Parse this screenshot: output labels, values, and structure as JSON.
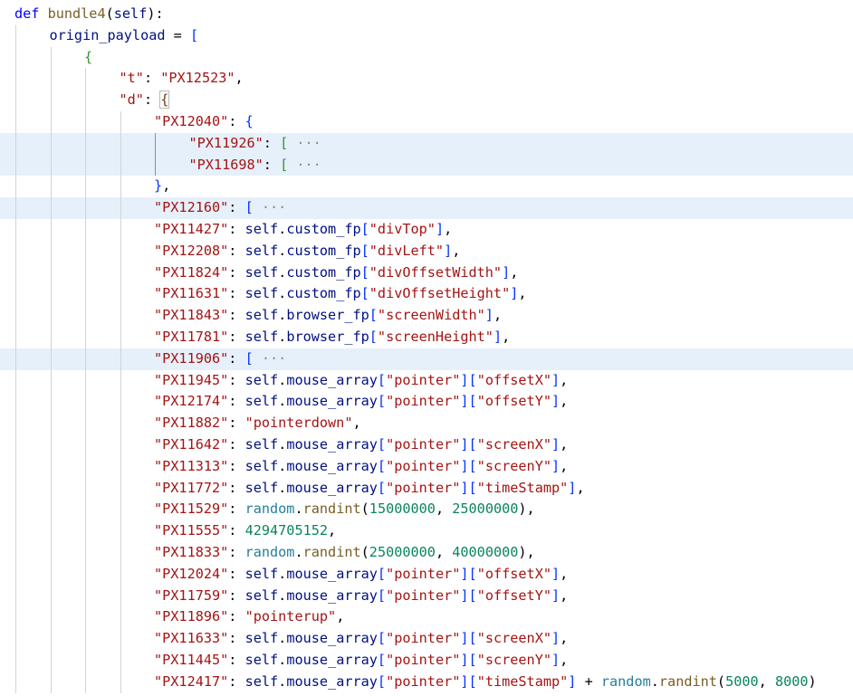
{
  "editor": {
    "lines": [
      {
        "indent": 0,
        "highlight": false,
        "tokens": [
          [
            "kw",
            "def"
          ],
          [
            "op",
            " "
          ],
          [
            "fn",
            "bundle4"
          ],
          [
            "op",
            "("
          ],
          [
            "self",
            "self"
          ],
          [
            "op",
            "):"
          ]
        ]
      },
      {
        "indent": 1,
        "highlight": false,
        "tokens": [
          [
            "id",
            "origin_payload"
          ],
          [
            "op",
            " = "
          ],
          [
            "b1",
            "["
          ]
        ]
      },
      {
        "indent": 2,
        "highlight": false,
        "tokens": [
          [
            "b2",
            "{"
          ]
        ]
      },
      {
        "indent": 3,
        "highlight": false,
        "tokens": [
          [
            "str",
            "\"t\""
          ],
          [
            "op",
            ": "
          ],
          [
            "str",
            "\"PX12523\""
          ],
          [
            "op",
            ","
          ]
        ]
      },
      {
        "indent": 3,
        "highlight": false,
        "tokens": [
          [
            "str",
            "\"d\""
          ],
          [
            "op",
            ": "
          ],
          [
            "b3box",
            "{"
          ]
        ]
      },
      {
        "indent": 4,
        "highlight": false,
        "tokens": [
          [
            "str",
            "\"PX12040\""
          ],
          [
            "op",
            ": "
          ],
          [
            "b1",
            "{"
          ]
        ]
      },
      {
        "indent": 5,
        "highlight": true,
        "tokens": [
          [
            "str",
            "\"PX11926\""
          ],
          [
            "op",
            ": "
          ],
          [
            "b2",
            "["
          ],
          [
            "ell",
            " ···"
          ]
        ]
      },
      {
        "indent": 5,
        "highlight": true,
        "tokens": [
          [
            "str",
            "\"PX11698\""
          ],
          [
            "op",
            ": "
          ],
          [
            "b2",
            "["
          ],
          [
            "ell",
            " ···"
          ]
        ]
      },
      {
        "indent": 4,
        "highlight": false,
        "tokens": [
          [
            "b1",
            "}"
          ],
          [
            "op",
            ","
          ]
        ]
      },
      {
        "indent": 4,
        "highlight": true,
        "tokens": [
          [
            "str",
            "\"PX12160\""
          ],
          [
            "op",
            ": "
          ],
          [
            "b1",
            "["
          ],
          [
            "ell",
            " ···"
          ]
        ]
      },
      {
        "indent": 4,
        "highlight": false,
        "tokens": [
          [
            "str",
            "\"PX11427\""
          ],
          [
            "op",
            ": "
          ],
          [
            "self",
            "self"
          ],
          [
            "op",
            "."
          ],
          [
            "id",
            "custom_fp"
          ],
          [
            "b1",
            "["
          ],
          [
            "str",
            "\"divTop\""
          ],
          [
            "b1",
            "]"
          ],
          [
            "op",
            ","
          ]
        ]
      },
      {
        "indent": 4,
        "highlight": false,
        "tokens": [
          [
            "str",
            "\"PX12208\""
          ],
          [
            "op",
            ": "
          ],
          [
            "self",
            "self"
          ],
          [
            "op",
            "."
          ],
          [
            "id",
            "custom_fp"
          ],
          [
            "b1",
            "["
          ],
          [
            "str",
            "\"divLeft\""
          ],
          [
            "b1",
            "]"
          ],
          [
            "op",
            ","
          ]
        ]
      },
      {
        "indent": 4,
        "highlight": false,
        "tokens": [
          [
            "str",
            "\"PX11824\""
          ],
          [
            "op",
            ": "
          ],
          [
            "self",
            "self"
          ],
          [
            "op",
            "."
          ],
          [
            "id",
            "custom_fp"
          ],
          [
            "b1",
            "["
          ],
          [
            "str",
            "\"divOffsetWidth\""
          ],
          [
            "b1",
            "]"
          ],
          [
            "op",
            ","
          ]
        ]
      },
      {
        "indent": 4,
        "highlight": false,
        "tokens": [
          [
            "str",
            "\"PX11631\""
          ],
          [
            "op",
            ": "
          ],
          [
            "self",
            "self"
          ],
          [
            "op",
            "."
          ],
          [
            "id",
            "custom_fp"
          ],
          [
            "b1",
            "["
          ],
          [
            "str",
            "\"divOffsetHeight\""
          ],
          [
            "b1",
            "]"
          ],
          [
            "op",
            ","
          ]
        ]
      },
      {
        "indent": 4,
        "highlight": false,
        "tokens": [
          [
            "str",
            "\"PX11843\""
          ],
          [
            "op",
            ": "
          ],
          [
            "self",
            "self"
          ],
          [
            "op",
            "."
          ],
          [
            "id",
            "browser_fp"
          ],
          [
            "b1",
            "["
          ],
          [
            "str",
            "\"screenWidth\""
          ],
          [
            "b1",
            "]"
          ],
          [
            "op",
            ","
          ]
        ]
      },
      {
        "indent": 4,
        "highlight": false,
        "tokens": [
          [
            "str",
            "\"PX11781\""
          ],
          [
            "op",
            ": "
          ],
          [
            "self",
            "self"
          ],
          [
            "op",
            "."
          ],
          [
            "id",
            "browser_fp"
          ],
          [
            "b1",
            "["
          ],
          [
            "str",
            "\"screenHeight\""
          ],
          [
            "b1",
            "]"
          ],
          [
            "op",
            ","
          ]
        ]
      },
      {
        "indent": 4,
        "highlight": true,
        "tokens": [
          [
            "str",
            "\"PX11906\""
          ],
          [
            "op",
            ": "
          ],
          [
            "b1",
            "["
          ],
          [
            "ell",
            " ···"
          ]
        ]
      },
      {
        "indent": 4,
        "highlight": false,
        "tokens": [
          [
            "str",
            "\"PX11945\""
          ],
          [
            "op",
            ": "
          ],
          [
            "self",
            "self"
          ],
          [
            "op",
            "."
          ],
          [
            "id",
            "mouse_array"
          ],
          [
            "b1",
            "["
          ],
          [
            "str",
            "\"pointer\""
          ],
          [
            "b1",
            "]"
          ],
          [
            "b1",
            "["
          ],
          [
            "str",
            "\"offsetX\""
          ],
          [
            "b1",
            "]"
          ],
          [
            "op",
            ","
          ]
        ]
      },
      {
        "indent": 4,
        "highlight": false,
        "tokens": [
          [
            "str",
            "\"PX12174\""
          ],
          [
            "op",
            ": "
          ],
          [
            "self",
            "self"
          ],
          [
            "op",
            "."
          ],
          [
            "id",
            "mouse_array"
          ],
          [
            "b1",
            "["
          ],
          [
            "str",
            "\"pointer\""
          ],
          [
            "b1",
            "]"
          ],
          [
            "b1",
            "["
          ],
          [
            "str",
            "\"offsetY\""
          ],
          [
            "b1",
            "]"
          ],
          [
            "op",
            ","
          ]
        ]
      },
      {
        "indent": 4,
        "highlight": false,
        "tokens": [
          [
            "str",
            "\"PX11882\""
          ],
          [
            "op",
            ": "
          ],
          [
            "str",
            "\"pointerdown\""
          ],
          [
            "op",
            ","
          ]
        ]
      },
      {
        "indent": 4,
        "highlight": false,
        "tokens": [
          [
            "str",
            "\"PX11642\""
          ],
          [
            "op",
            ": "
          ],
          [
            "self",
            "self"
          ],
          [
            "op",
            "."
          ],
          [
            "id",
            "mouse_array"
          ],
          [
            "b1",
            "["
          ],
          [
            "str",
            "\"pointer\""
          ],
          [
            "b1",
            "]"
          ],
          [
            "b1",
            "["
          ],
          [
            "str",
            "\"screenX\""
          ],
          [
            "b1",
            "]"
          ],
          [
            "op",
            ","
          ]
        ]
      },
      {
        "indent": 4,
        "highlight": false,
        "tokens": [
          [
            "str",
            "\"PX11313\""
          ],
          [
            "op",
            ": "
          ],
          [
            "self",
            "self"
          ],
          [
            "op",
            "."
          ],
          [
            "id",
            "mouse_array"
          ],
          [
            "b1",
            "["
          ],
          [
            "str",
            "\"pointer\""
          ],
          [
            "b1",
            "]"
          ],
          [
            "b1",
            "["
          ],
          [
            "str",
            "\"screenY\""
          ],
          [
            "b1",
            "]"
          ],
          [
            "op",
            ","
          ]
        ]
      },
      {
        "indent": 4,
        "highlight": false,
        "tokens": [
          [
            "str",
            "\"PX11772\""
          ],
          [
            "op",
            ": "
          ],
          [
            "self",
            "self"
          ],
          [
            "op",
            "."
          ],
          [
            "id",
            "mouse_array"
          ],
          [
            "b1",
            "["
          ],
          [
            "str",
            "\"pointer\""
          ],
          [
            "b1",
            "]"
          ],
          [
            "b1",
            "["
          ],
          [
            "str",
            "\"timeStamp\""
          ],
          [
            "b1",
            "]"
          ],
          [
            "op",
            ","
          ]
        ]
      },
      {
        "indent": 4,
        "highlight": false,
        "tokens": [
          [
            "str",
            "\"PX11529\""
          ],
          [
            "op",
            ": "
          ],
          [
            "cls",
            "random"
          ],
          [
            "op",
            "."
          ],
          [
            "fn",
            "randint"
          ],
          [
            "op",
            "("
          ],
          [
            "num",
            "15000000"
          ],
          [
            "op",
            ", "
          ],
          [
            "num",
            "25000000"
          ],
          [
            "op",
            "),"
          ]
        ]
      },
      {
        "indent": 4,
        "highlight": false,
        "tokens": [
          [
            "str",
            "\"PX11555\""
          ],
          [
            "op",
            ": "
          ],
          [
            "num",
            "4294705152"
          ],
          [
            "op",
            ","
          ]
        ]
      },
      {
        "indent": 4,
        "highlight": false,
        "tokens": [
          [
            "str",
            "\"PX11833\""
          ],
          [
            "op",
            ": "
          ],
          [
            "cls",
            "random"
          ],
          [
            "op",
            "."
          ],
          [
            "fn",
            "randint"
          ],
          [
            "op",
            "("
          ],
          [
            "num",
            "25000000"
          ],
          [
            "op",
            ", "
          ],
          [
            "num",
            "40000000"
          ],
          [
            "op",
            "),"
          ]
        ]
      },
      {
        "indent": 4,
        "highlight": false,
        "tokens": [
          [
            "str",
            "\"PX12024\""
          ],
          [
            "op",
            ": "
          ],
          [
            "self",
            "self"
          ],
          [
            "op",
            "."
          ],
          [
            "id",
            "mouse_array"
          ],
          [
            "b1",
            "["
          ],
          [
            "str",
            "\"pointer\""
          ],
          [
            "b1",
            "]"
          ],
          [
            "b1",
            "["
          ],
          [
            "str",
            "\"offsetX\""
          ],
          [
            "b1",
            "]"
          ],
          [
            "op",
            ","
          ]
        ]
      },
      {
        "indent": 4,
        "highlight": false,
        "tokens": [
          [
            "str",
            "\"PX11759\""
          ],
          [
            "op",
            ": "
          ],
          [
            "self",
            "self"
          ],
          [
            "op",
            "."
          ],
          [
            "id",
            "mouse_array"
          ],
          [
            "b1",
            "["
          ],
          [
            "str",
            "\"pointer\""
          ],
          [
            "b1",
            "]"
          ],
          [
            "b1",
            "["
          ],
          [
            "str",
            "\"offsetY\""
          ],
          [
            "b1",
            "]"
          ],
          [
            "op",
            ","
          ]
        ]
      },
      {
        "indent": 4,
        "highlight": false,
        "tokens": [
          [
            "str",
            "\"PX11896\""
          ],
          [
            "op",
            ": "
          ],
          [
            "str",
            "\"pointerup\""
          ],
          [
            "op",
            ","
          ]
        ]
      },
      {
        "indent": 4,
        "highlight": false,
        "tokens": [
          [
            "str",
            "\"PX11633\""
          ],
          [
            "op",
            ": "
          ],
          [
            "self",
            "self"
          ],
          [
            "op",
            "."
          ],
          [
            "id",
            "mouse_array"
          ],
          [
            "b1",
            "["
          ],
          [
            "str",
            "\"pointer\""
          ],
          [
            "b1",
            "]"
          ],
          [
            "b1",
            "["
          ],
          [
            "str",
            "\"screenX\""
          ],
          [
            "b1",
            "]"
          ],
          [
            "op",
            ","
          ]
        ]
      },
      {
        "indent": 4,
        "highlight": false,
        "tokens": [
          [
            "str",
            "\"PX11445\""
          ],
          [
            "op",
            ": "
          ],
          [
            "self",
            "self"
          ],
          [
            "op",
            "."
          ],
          [
            "id",
            "mouse_array"
          ],
          [
            "b1",
            "["
          ],
          [
            "str",
            "\"pointer\""
          ],
          [
            "b1",
            "]"
          ],
          [
            "b1",
            "["
          ],
          [
            "str",
            "\"screenY\""
          ],
          [
            "b1",
            "]"
          ],
          [
            "op",
            ","
          ]
        ]
      },
      {
        "indent": 4,
        "highlight": false,
        "tokens": [
          [
            "str",
            "\"PX12417\""
          ],
          [
            "op",
            ": "
          ],
          [
            "self",
            "self"
          ],
          [
            "op",
            "."
          ],
          [
            "id",
            "mouse_array"
          ],
          [
            "b1",
            "["
          ],
          [
            "str",
            "\"pointer\""
          ],
          [
            "b1",
            "]"
          ],
          [
            "b1",
            "["
          ],
          [
            "str",
            "\"timeStamp\""
          ],
          [
            "b1",
            "]"
          ],
          [
            "op",
            " + "
          ],
          [
            "cls",
            "random"
          ],
          [
            "op",
            "."
          ],
          [
            "fn",
            "randint"
          ],
          [
            "op",
            "("
          ],
          [
            "num",
            "5000"
          ],
          [
            "op",
            ", "
          ],
          [
            "num",
            "8000"
          ],
          [
            "op",
            ")"
          ]
        ]
      }
    ]
  }
}
